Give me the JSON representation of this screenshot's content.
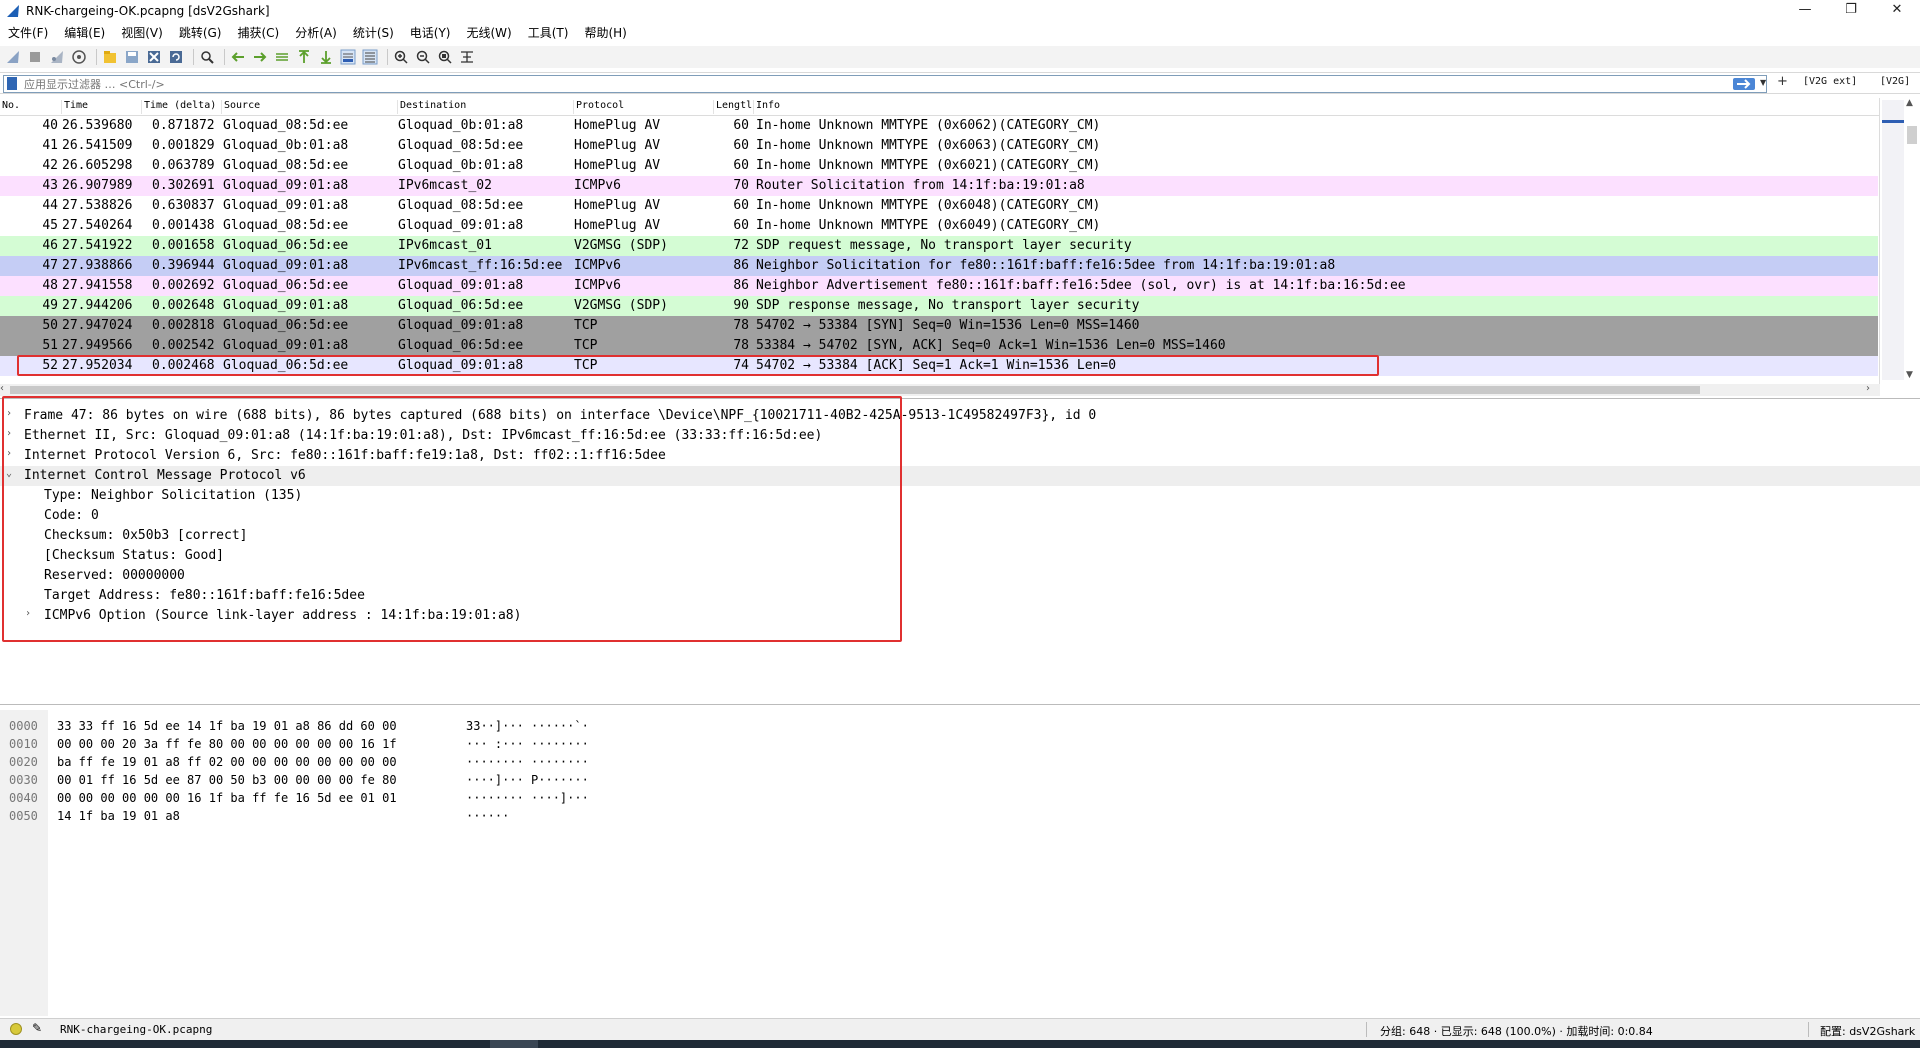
{
  "window": {
    "title": "RNK-chargeing-OK.pcapng [dsV2Gshark]",
    "controls": {
      "minimize": "—",
      "maximize": "❐",
      "close": "✕"
    }
  },
  "menu": [
    "文件(F)",
    "编辑(E)",
    "视图(V)",
    "跳转(G)",
    "捕获(C)",
    "分析(A)",
    "统计(S)",
    "电话(Y)",
    "无线(W)",
    "工具(T)",
    "帮助(H)"
  ],
  "toolbar_icons": [
    "shark-start-icon",
    "stop-icon",
    "restart-icon",
    "capture-options-icon",
    "open-file-icon",
    "save-file-icon",
    "close-file-icon",
    "reload-icon",
    "find-icon",
    "go-back-icon",
    "go-forward-icon",
    "go-to-packet-icon",
    "first-packet-icon",
    "last-packet-icon",
    "autoscroll-icon",
    "colorize-icon",
    "zoom-in-icon",
    "zoom-out-icon",
    "normal-size-icon",
    "resize-columns-icon"
  ],
  "filter": {
    "placeholder": "应用显示过滤器 … <Ctrl-/>",
    "buttons": {
      "plus": "+",
      "v2g_ext": "[V2G ext]",
      "v2g": "[V2G]"
    }
  },
  "packet_list": {
    "columns": {
      "no": "No.",
      "time": "Time",
      "delta": "Time (delta)",
      "source": "Source",
      "destination": "Destination",
      "protocol": "Protocol",
      "length": "Lengtl",
      "info": "Info"
    },
    "rows": [
      {
        "no": "40",
        "time": "26.539680",
        "delta": "0.871872",
        "src": "Gloquad_08:5d:ee",
        "dst": "Gloquad_0b:01:a8",
        "proto": "HomePlug AV",
        "len": "60",
        "info": "In-home Unknown MMTYPE (0x6062)(CATEGORY_CM)",
        "style": "homeplug"
      },
      {
        "no": "41",
        "time": "26.541509",
        "delta": "0.001829",
        "src": "Gloquad_0b:01:a8",
        "dst": "Gloquad_08:5d:ee",
        "proto": "HomePlug AV",
        "len": "60",
        "info": "In-home Unknown MMTYPE (0x6063)(CATEGORY_CM)",
        "style": "homeplug"
      },
      {
        "no": "42",
        "time": "26.605298",
        "delta": "0.063789",
        "src": "Gloquad_08:5d:ee",
        "dst": "Gloquad_0b:01:a8",
        "proto": "HomePlug AV",
        "len": "60",
        "info": "In-home Unknown MMTYPE (0x6021)(CATEGORY_CM)",
        "style": "homeplug"
      },
      {
        "no": "43",
        "time": "26.907989",
        "delta": "0.302691",
        "src": "Gloquad_09:01:a8",
        "dst": "IPv6mcast_02",
        "proto": "ICMPv6",
        "len": "70",
        "info": "Router Solicitation from 14:1f:ba:19:01:a8",
        "style": "icmpv6"
      },
      {
        "no": "44",
        "time": "27.538826",
        "delta": "0.630837",
        "src": "Gloquad_09:01:a8",
        "dst": "Gloquad_08:5d:ee",
        "proto": "HomePlug AV",
        "len": "60",
        "info": "In-home Unknown MMTYPE (0x6048)(CATEGORY_CM)",
        "style": "homeplug"
      },
      {
        "no": "45",
        "time": "27.540264",
        "delta": "0.001438",
        "src": "Gloquad_08:5d:ee",
        "dst": "Gloquad_09:01:a8",
        "proto": "HomePlug AV",
        "len": "60",
        "info": "In-home Unknown MMTYPE (0x6049)(CATEGORY_CM)",
        "style": "homeplug"
      },
      {
        "no": "46",
        "time": "27.541922",
        "delta": "0.001658",
        "src": "Gloquad_06:5d:ee",
        "dst": "IPv6mcast_01",
        "proto": "V2GMSG (SDP)",
        "len": "72",
        "info": "SDP request message, No transport layer security",
        "style": "v2g"
      },
      {
        "no": "47",
        "time": "27.938866",
        "delta": "0.396944",
        "src": "Gloquad_09:01:a8",
        "dst": "IPv6mcast_ff:16:5d:ee",
        "proto": "ICMPv6",
        "len": "86",
        "info": "Neighbor Solicitation for fe80::161f:baff:fe16:5dee from 14:1f:ba:19:01:a8",
        "style": "selected"
      },
      {
        "no": "48",
        "time": "27.941558",
        "delta": "0.002692",
        "src": "Gloquad_06:5d:ee",
        "dst": "Gloquad_09:01:a8",
        "proto": "ICMPv6",
        "len": "86",
        "info": "Neighbor Advertisement fe80::161f:baff:fe16:5dee (sol, ovr) is at 14:1f:ba:16:5d:ee",
        "style": "icmpv6"
      },
      {
        "no": "49",
        "time": "27.944206",
        "delta": "0.002648",
        "src": "Gloquad_09:01:a8",
        "dst": "Gloquad_06:5d:ee",
        "proto": "V2GMSG (SDP)",
        "len": "90",
        "info": "SDP response message, No transport layer security",
        "style": "v2g"
      },
      {
        "no": "50",
        "time": "27.947024",
        "delta": "0.002818",
        "src": "Gloquad_06:5d:ee",
        "dst": "Gloquad_09:01:a8",
        "proto": "TCP",
        "len": "78",
        "info": "54702 → 53384 [SYN] Seq=0 Win=1536 Len=0 MSS=1460",
        "style": "tcp-syn"
      },
      {
        "no": "51",
        "time": "27.949566",
        "delta": "0.002542",
        "src": "Gloquad_09:01:a8",
        "dst": "Gloquad_06:5d:ee",
        "proto": "TCP",
        "len": "78",
        "info": "53384 → 54702 [SYN, ACK] Seq=0 Ack=1 Win=1536 Len=0 MSS=1460",
        "style": "tcp-syn"
      },
      {
        "no": "52",
        "time": "27.952034",
        "delta": "0.002468",
        "src": "Gloquad_06:5d:ee",
        "dst": "Gloquad_09:01:a8",
        "proto": "TCP",
        "len": "74",
        "info": "54702 → 53384 [ACK] Seq=1 Ack=1 Win=1536 Len=0",
        "style": "tcp"
      }
    ]
  },
  "details": [
    {
      "level": 0,
      "arrow": "›",
      "text": "Frame 47: 86 bytes on wire (688 bits), 86 bytes captured (688 bits) on interface \\Device\\NPF_{10021711-40B2-425A-9513-1C49582497F3}, id 0"
    },
    {
      "level": 0,
      "arrow": "›",
      "text": "Ethernet II, Src: Gloquad_09:01:a8 (14:1f:ba:19:01:a8), Dst: IPv6mcast_ff:16:5d:ee (33:33:ff:16:5d:ee)"
    },
    {
      "level": 0,
      "arrow": "›",
      "text": "Internet Protocol Version 6, Src: fe80::161f:baff:fe19:1a8, Dst: ff02::1:ff16:5dee"
    },
    {
      "level": 0,
      "arrow": "⌄",
      "text": "Internet Control Message Protocol v6",
      "expanded": true
    },
    {
      "level": 1,
      "arrow": "",
      "text": "Type: Neighbor Solicitation (135)"
    },
    {
      "level": 1,
      "arrow": "",
      "text": "Code: 0"
    },
    {
      "level": 1,
      "arrow": "",
      "text": "Checksum: 0x50b3 [correct]"
    },
    {
      "level": 1,
      "arrow": "",
      "text": "[Checksum Status: Good]"
    },
    {
      "level": 1,
      "arrow": "",
      "text": "Reserved: 00000000"
    },
    {
      "level": 1,
      "arrow": "",
      "text": "Target Address: fe80::161f:baff:fe16:5dee"
    },
    {
      "level": 1,
      "arrow": "›",
      "text": "ICMPv6 Option (Source link-layer address : 14:1f:ba:19:01:a8)"
    }
  ],
  "bytes": [
    {
      "off": "0000",
      "hex": "33 33 ff 16 5d ee 14 1f  ba 19 01 a8 86 dd 60 00",
      "ascii": "33··]··· ······`·"
    },
    {
      "off": "0010",
      "hex": "00 00 00 20 3a ff fe 80  00 00 00 00 00 00 16 1f",
      "ascii": "··· :··· ········"
    },
    {
      "off": "0020",
      "hex": "ba ff fe 19 01 a8 ff 02  00 00 00 00 00 00 00 00",
      "ascii": "········ ········"
    },
    {
      "off": "0030",
      "hex": "00 01 ff 16 5d ee 87 00  50 b3 00 00 00 00 fe 80",
      "ascii": "····]··· P·······"
    },
    {
      "off": "0040",
      "hex": "00 00 00 00 00 00 16 1f  ba ff fe 16 5d ee 01 01",
      "ascii": "········ ····]···"
    },
    {
      "off": "0050",
      "hex": "14 1f ba 19 01 a8",
      "ascii": "······"
    }
  ],
  "status": {
    "file": "RNK-chargeing-OK.pcapng",
    "stats": "分组: 648 · 已显示: 648 (100.0%) · 加载时间: 0:0.84",
    "profile": "配置: dsV2Gshark"
  },
  "colors": {
    "homeplug": "#ffffff",
    "icmpv6": "#fce0ff",
    "v2g": "#d4fcd4",
    "tcp_syn": "#a0a0a0",
    "tcp": "#e7e6ff",
    "selected": "#c5cdf5",
    "highlight": "#e03030"
  }
}
